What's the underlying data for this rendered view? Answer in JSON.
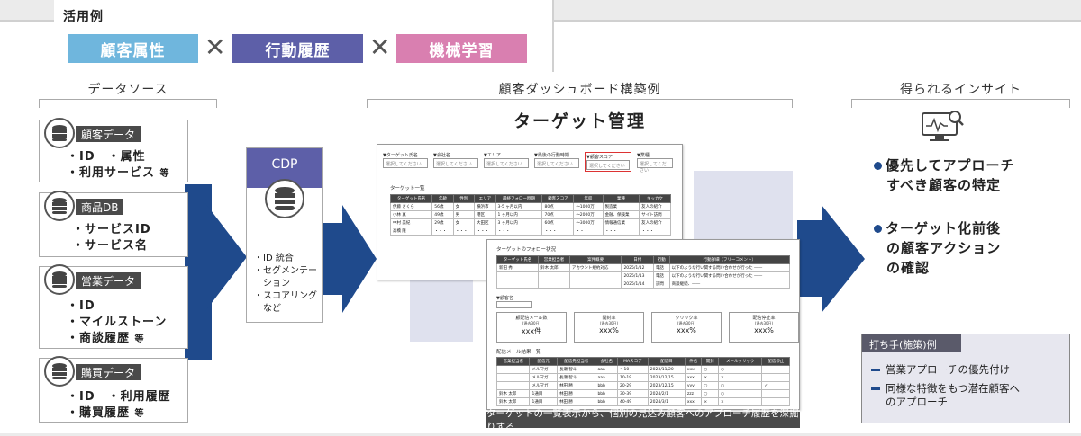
{
  "usage": {
    "title": "活用例",
    "tags": [
      {
        "label": "顧客属性",
        "color": "#6fb6dd"
      },
      {
        "label": "行動履歴",
        "color": "#5d5fa8"
      },
      {
        "label": "機械学習",
        "color": "#d97fb0"
      }
    ],
    "times": "✕"
  },
  "sections": {
    "source": "データソース",
    "dashboard": "顧客ダッシュボード構築例",
    "insight": "得られるインサイト"
  },
  "sources": [
    {
      "head": "顧客データ",
      "lines": [
        "・ID　・属性",
        "・利用サービス"
      ],
      "suffix": "等"
    },
    {
      "head": "商品DB",
      "lines": [
        "・サービスID",
        "・サービス名"
      ],
      "suffix": ""
    },
    {
      "head": "営業データ",
      "lines": [
        "・ID",
        "・マイルストーン",
        "・商談履歴"
      ],
      "suffix": "等"
    },
    {
      "head": "購買データ",
      "lines": [
        "・ID　・利用履歴",
        "・購買履歴"
      ],
      "suffix": "等"
    }
  ],
  "cdp": {
    "title": "CDP",
    "items": [
      "・ID 統合",
      "・セグメンテー",
      "　ション",
      "・スコアリング",
      "　など"
    ]
  },
  "dashboard": {
    "title": "ターゲット管理",
    "filters": [
      "▼ターゲット氏名",
      "▼会社名",
      "▼エリア",
      "▼最後の行動時期",
      "▼顧客スコア",
      "▼業種"
    ],
    "filter_placeholder": "選択してください",
    "list_title": "ターゲット一覧",
    "list_headers": [
      "ターゲット氏名",
      "年齢",
      "性別",
      "エリア",
      "最終フォロー時期",
      "顧客スコア",
      "年収",
      "業種",
      "キッカケ"
    ],
    "list_rows": [
      [
        "伊藤 さくら",
        "56歳",
        "女",
        "横浜市",
        "3-5 ヶ月以内",
        "80点",
        "～1000万",
        "製造業",
        "友人の紹介"
      ],
      [
        "小林 真",
        "49歳",
        "男",
        "港区",
        "1 ヶ月以内",
        "70点",
        "～2000万",
        "金融、保険業",
        "サイト訪問"
      ],
      [
        "中村 美紀",
        "29歳",
        "女",
        "大田区",
        "3 ヶ月以内",
        "60点",
        "～3000万",
        "情報通信業",
        "友人の紹介"
      ],
      [
        "高橋 隆",
        "・・・",
        "・・・",
        "・・・",
        "・・・",
        "・・・",
        "・・・",
        "・・・",
        "・・・"
      ]
    ],
    "follow_title": "ターゲットのフォロー状況",
    "follow_headers": [
      "ターゲット氏名",
      "営業担当者",
      "案件概要",
      "日付",
      "行動",
      "行動詳細（フリーコメント）"
    ],
    "follow_rows": [
      [
        "新田 秀",
        "鈴木 太郎",
        "アカウント規約対応",
        "2025/1/12",
        "電話",
        "以下のような行い関する問い合わせが行った ――"
      ],
      [
        "",
        "",
        "",
        "2025/1/13",
        "電話",
        "以下のような行い関する問い合わせが行った ――"
      ],
      [
        "",
        "",
        "",
        "2025/1/14",
        "訪問",
        "商談継続、――"
      ]
    ],
    "small_filter": "▼顧客名",
    "kpis": [
      {
        "label": "顧配信メール数",
        "sub": "(過去30日)",
        "value": "xxx件"
      },
      {
        "label": "開封率",
        "sub": "(過去30日)",
        "value": "xxx%"
      },
      {
        "label": "クリック率",
        "sub": "(過去30日)",
        "value": "xxx%"
      },
      {
        "label": "配信停止率",
        "sub": "(過去30日)",
        "value": "xxx%"
      }
    ],
    "mail_title": "配信メール結果一覧",
    "mail_headers": [
      "営業担当者",
      "配信元",
      "配信先担当者",
      "会社名",
      "MAスコア",
      "配信日",
      "件名",
      "開封",
      "メールクリック",
      "配信停止"
    ],
    "mail_rows": [
      [
        "",
        "メルマガ",
        "長瀬 智斗",
        "aaa",
        "～10",
        "2023/11/20",
        "xxx",
        "○",
        "○",
        ""
      ],
      [
        "",
        "メルマガ",
        "長瀬 智斗",
        "aaa",
        "10-19",
        "2023/12/15",
        "xxx",
        "×",
        "×",
        ""
      ],
      [
        "",
        "メルマガ",
        "林田 勝",
        "bbb",
        "20-29",
        "2023/12/15",
        "yyy",
        "○",
        "○",
        "✓"
      ],
      [
        "鈴木 太郎",
        "1通目",
        "林田 勝",
        "bbb",
        "30-39",
        "2024/2/1",
        "zzz",
        "○",
        "○",
        ""
      ],
      [
        "鈴木 太郎",
        "1通目",
        "林田 勝",
        "bbb",
        "40-49",
        "2024/3/1",
        "xxx",
        "×",
        "×",
        ""
      ]
    ],
    "caption": "ターゲットの一覧表示から、個別の見込み顧客へのアプローチ履歴を深掘りする"
  },
  "insights": [
    {
      "lines": [
        "優先してアプローチ",
        "すべき顧客の特定"
      ]
    },
    {
      "lines": [
        "ターゲット化前後",
        "の顧客アクション",
        "の確認"
      ]
    }
  ],
  "measures": {
    "title": "打ち手(施策)例",
    "items": [
      [
        "営業アプローチの優先付け"
      ],
      [
        "同様な特徴をもつ潜在顧客へ",
        "のアプローチ"
      ]
    ]
  }
}
